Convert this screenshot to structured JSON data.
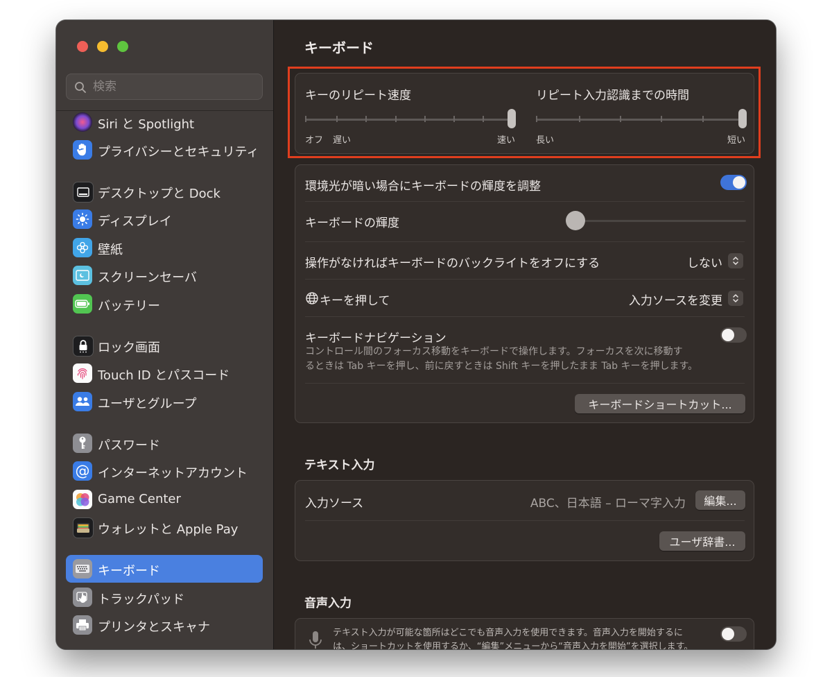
{
  "window": {
    "colors": {
      "accent": "#4a80e0",
      "highlight_border": "#e03e1e"
    }
  },
  "search": {
    "placeholder": "検索"
  },
  "sidebar": {
    "items": [
      {
        "label": "Siri と Spotlight",
        "icon": "siri-icon"
      },
      {
        "label": "プライバシーとセキュリティ",
        "icon": "hand-icon"
      },
      {
        "label": "デスクトップと Dock",
        "icon": "dock-icon"
      },
      {
        "label": "ディスプレイ",
        "icon": "display-sun-icon"
      },
      {
        "label": "壁紙",
        "icon": "wallpaper-flower-icon"
      },
      {
        "label": "スクリーンセーバ",
        "icon": "screensaver-icon"
      },
      {
        "label": "バッテリー",
        "icon": "battery-icon"
      },
      {
        "label": "ロック画面",
        "icon": "lock-icon"
      },
      {
        "label": "Touch ID とパスコード",
        "icon": "fingerprint-icon"
      },
      {
        "label": "ユーザとグループ",
        "icon": "users-icon"
      },
      {
        "label": "パスワード",
        "icon": "key-icon"
      },
      {
        "label": "インターネットアカウント",
        "icon": "at-icon"
      },
      {
        "label": "Game Center",
        "icon": "game-center-icon"
      },
      {
        "label": "ウォレットと Apple Pay",
        "icon": "wallet-icon"
      },
      {
        "label": "キーボード",
        "icon": "keyboard-icon",
        "selected": true
      },
      {
        "label": "トラックパッド",
        "icon": "trackpad-icon"
      },
      {
        "label": "プリンタとスキャナ",
        "icon": "printer-icon"
      }
    ]
  },
  "main": {
    "title": "キーボード",
    "repeat": {
      "key_repeat_label": "キーのリピート速度",
      "key_repeat_left1": "オフ",
      "key_repeat_left2": "遅い",
      "key_repeat_right": "速い",
      "key_repeat_value": 1.0,
      "delay_label": "リピート入力認識までの時間",
      "delay_left": "長い",
      "delay_right": "短い",
      "delay_value": 1.0
    },
    "settings": {
      "ambient_label": "環境光が暗い場合にキーボードの輝度を調整",
      "ambient_on": true,
      "brightness_label": "キーボードの輝度",
      "brightness_value": 0.0,
      "backlight_off_label": "操作がなければキーボードのバックライトをオフにする",
      "backlight_off_value": "しない",
      "globe_label": "キーを押して",
      "globe_value": "入力ソースを変更",
      "nav_label": "キーボードナビゲーション",
      "nav_desc_line1": "コントロール間のフォーカス移動をキーボードで操作します。フォーカスを次に移動す",
      "nav_desc_line2": "るときは Tab キーを押し、前に戻すときは Shift キーを押したまま Tab キーを押します。",
      "nav_on": false,
      "shortcuts_button": "キーボードショートカット..."
    },
    "text_input": {
      "section_title": "テキスト入力",
      "input_sources_label": "入力ソース",
      "input_sources_value": "ABC、日本語 – ローマ字入力",
      "edit_button": "編集...",
      "user_dict_button": "ユーザ辞書..."
    },
    "dictation": {
      "section_title": "音声入力",
      "desc_line1": "テキスト入力が可能な箇所はどこでも音声入力を使用できます。音声入力を開始するに",
      "desc_line2": "は、ショートカットを使用するか、“編集”メニューから“音声入力を開始”を選択します。",
      "on": false
    }
  }
}
